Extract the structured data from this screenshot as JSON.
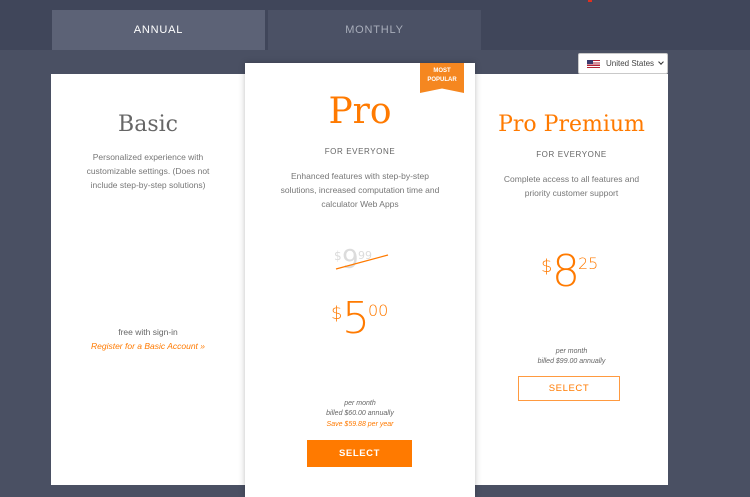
{
  "tabs": {
    "annual": "ANNUAL",
    "monthly": "MONTHLY"
  },
  "country_selector": {
    "flag_icon": "us-flag-icon",
    "label": "United States",
    "chevron_icon": "chevron-down-icon"
  },
  "plans": {
    "basic": {
      "name": "Basic",
      "description": "Personalized experience with customizable settings. (Does not include step-by-step solutions)",
      "free_text": "free with sign-in",
      "register_link": "Register for a Basic Account »"
    },
    "pro": {
      "badge": "MOST POPULAR",
      "name": "Pro",
      "audience": "FOR EVERYONE",
      "description": "Enhanced features with step-by-step solutions, increased computation time and calculator Web Apps",
      "old_price": {
        "symbol": "$",
        "whole": "9",
        "cents": "99"
      },
      "price": {
        "symbol": "$",
        "whole": "5",
        "cents": "00"
      },
      "per": "per month",
      "billed": "billed $60.00 annually",
      "savings": "Save $59.88 per year",
      "button": "SELECT"
    },
    "premium": {
      "name": "Pro Premium",
      "audience": "FOR EVERYONE",
      "description": "Complete access to all features and priority customer support",
      "price": {
        "symbol": "$",
        "whole": "8",
        "cents": "25"
      },
      "per": "per month",
      "billed": "billed $99.00 annually",
      "button": "SELECT"
    }
  },
  "colors": {
    "accent": "#ff7a00",
    "background": "#4a5063",
    "tab_active": "#5c6276"
  }
}
